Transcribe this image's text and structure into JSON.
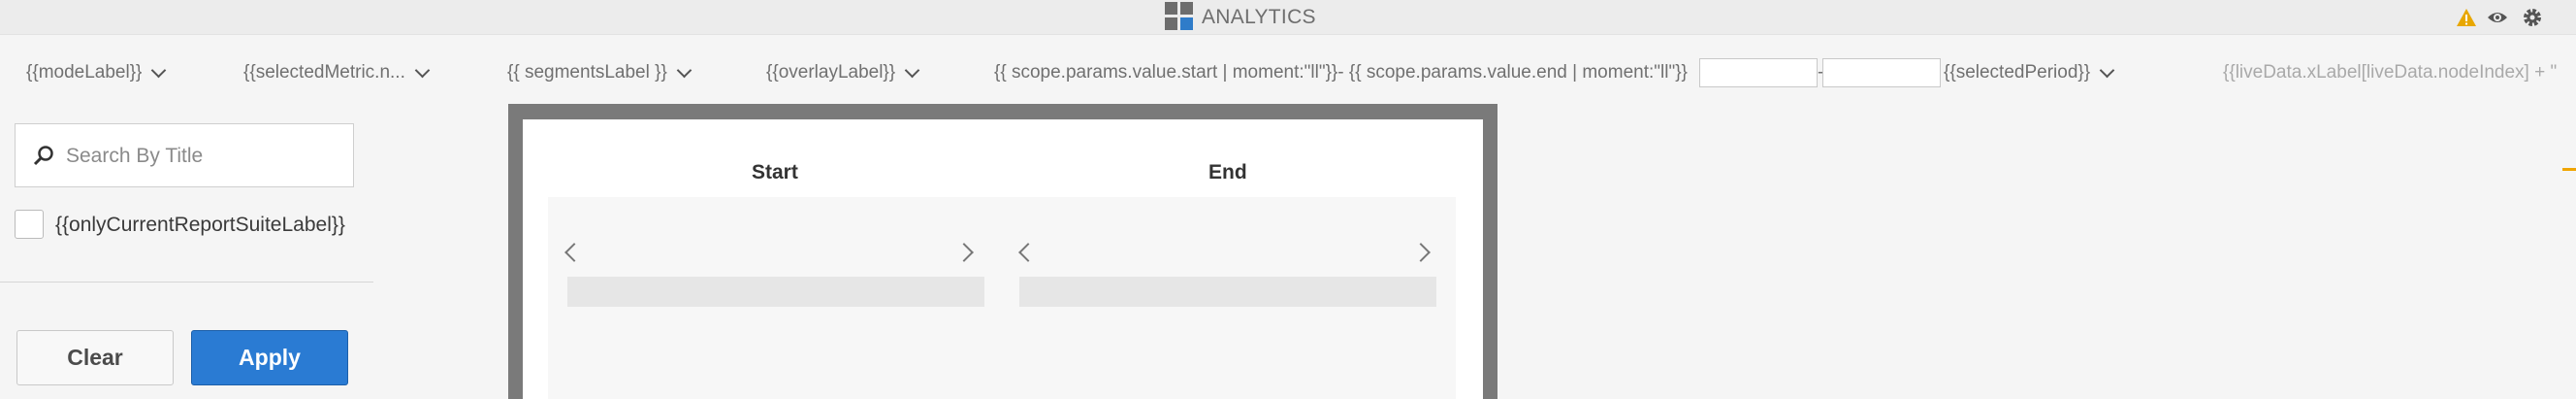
{
  "titlebar": {
    "title": "ANALYTICS",
    "logo_colors": [
      "#6d6d6d",
      "#6d6d6d",
      "#6d6d6d",
      "#2f7cc9"
    ],
    "icons": [
      "warning-icon",
      "eye-icon",
      "gear-icon"
    ],
    "warning_color": "#e8a700"
  },
  "toolbar": {
    "mode_label": "{{modeLabel}}",
    "metric_label": "{{selectedMetric.n...",
    "segments_label": "{{ segmentsLabel }}",
    "overlay_label": "{{overlayLabel}}",
    "date_range_label": "{{ scope.params.value.start | moment:\"ll\"}}- {{ scope.params.value.end | moment:\"ll\"}}",
    "date_separator": "-",
    "period_label": "{{selectedPeriod}}",
    "live_data_label": "{{liveData.xLabel[liveData.nodeIndex] + \""
  },
  "sidebar": {
    "search_placeholder": "Search By Title",
    "checkbox_label": "{{onlyCurrentReportSuiteLabel}}",
    "clear_label": "Clear",
    "apply_label": "Apply"
  },
  "calendar": {
    "start_label": "Start",
    "end_label": "End"
  },
  "colors": {
    "accent": "#2a7bd3",
    "frame": "#7a7a7a"
  }
}
